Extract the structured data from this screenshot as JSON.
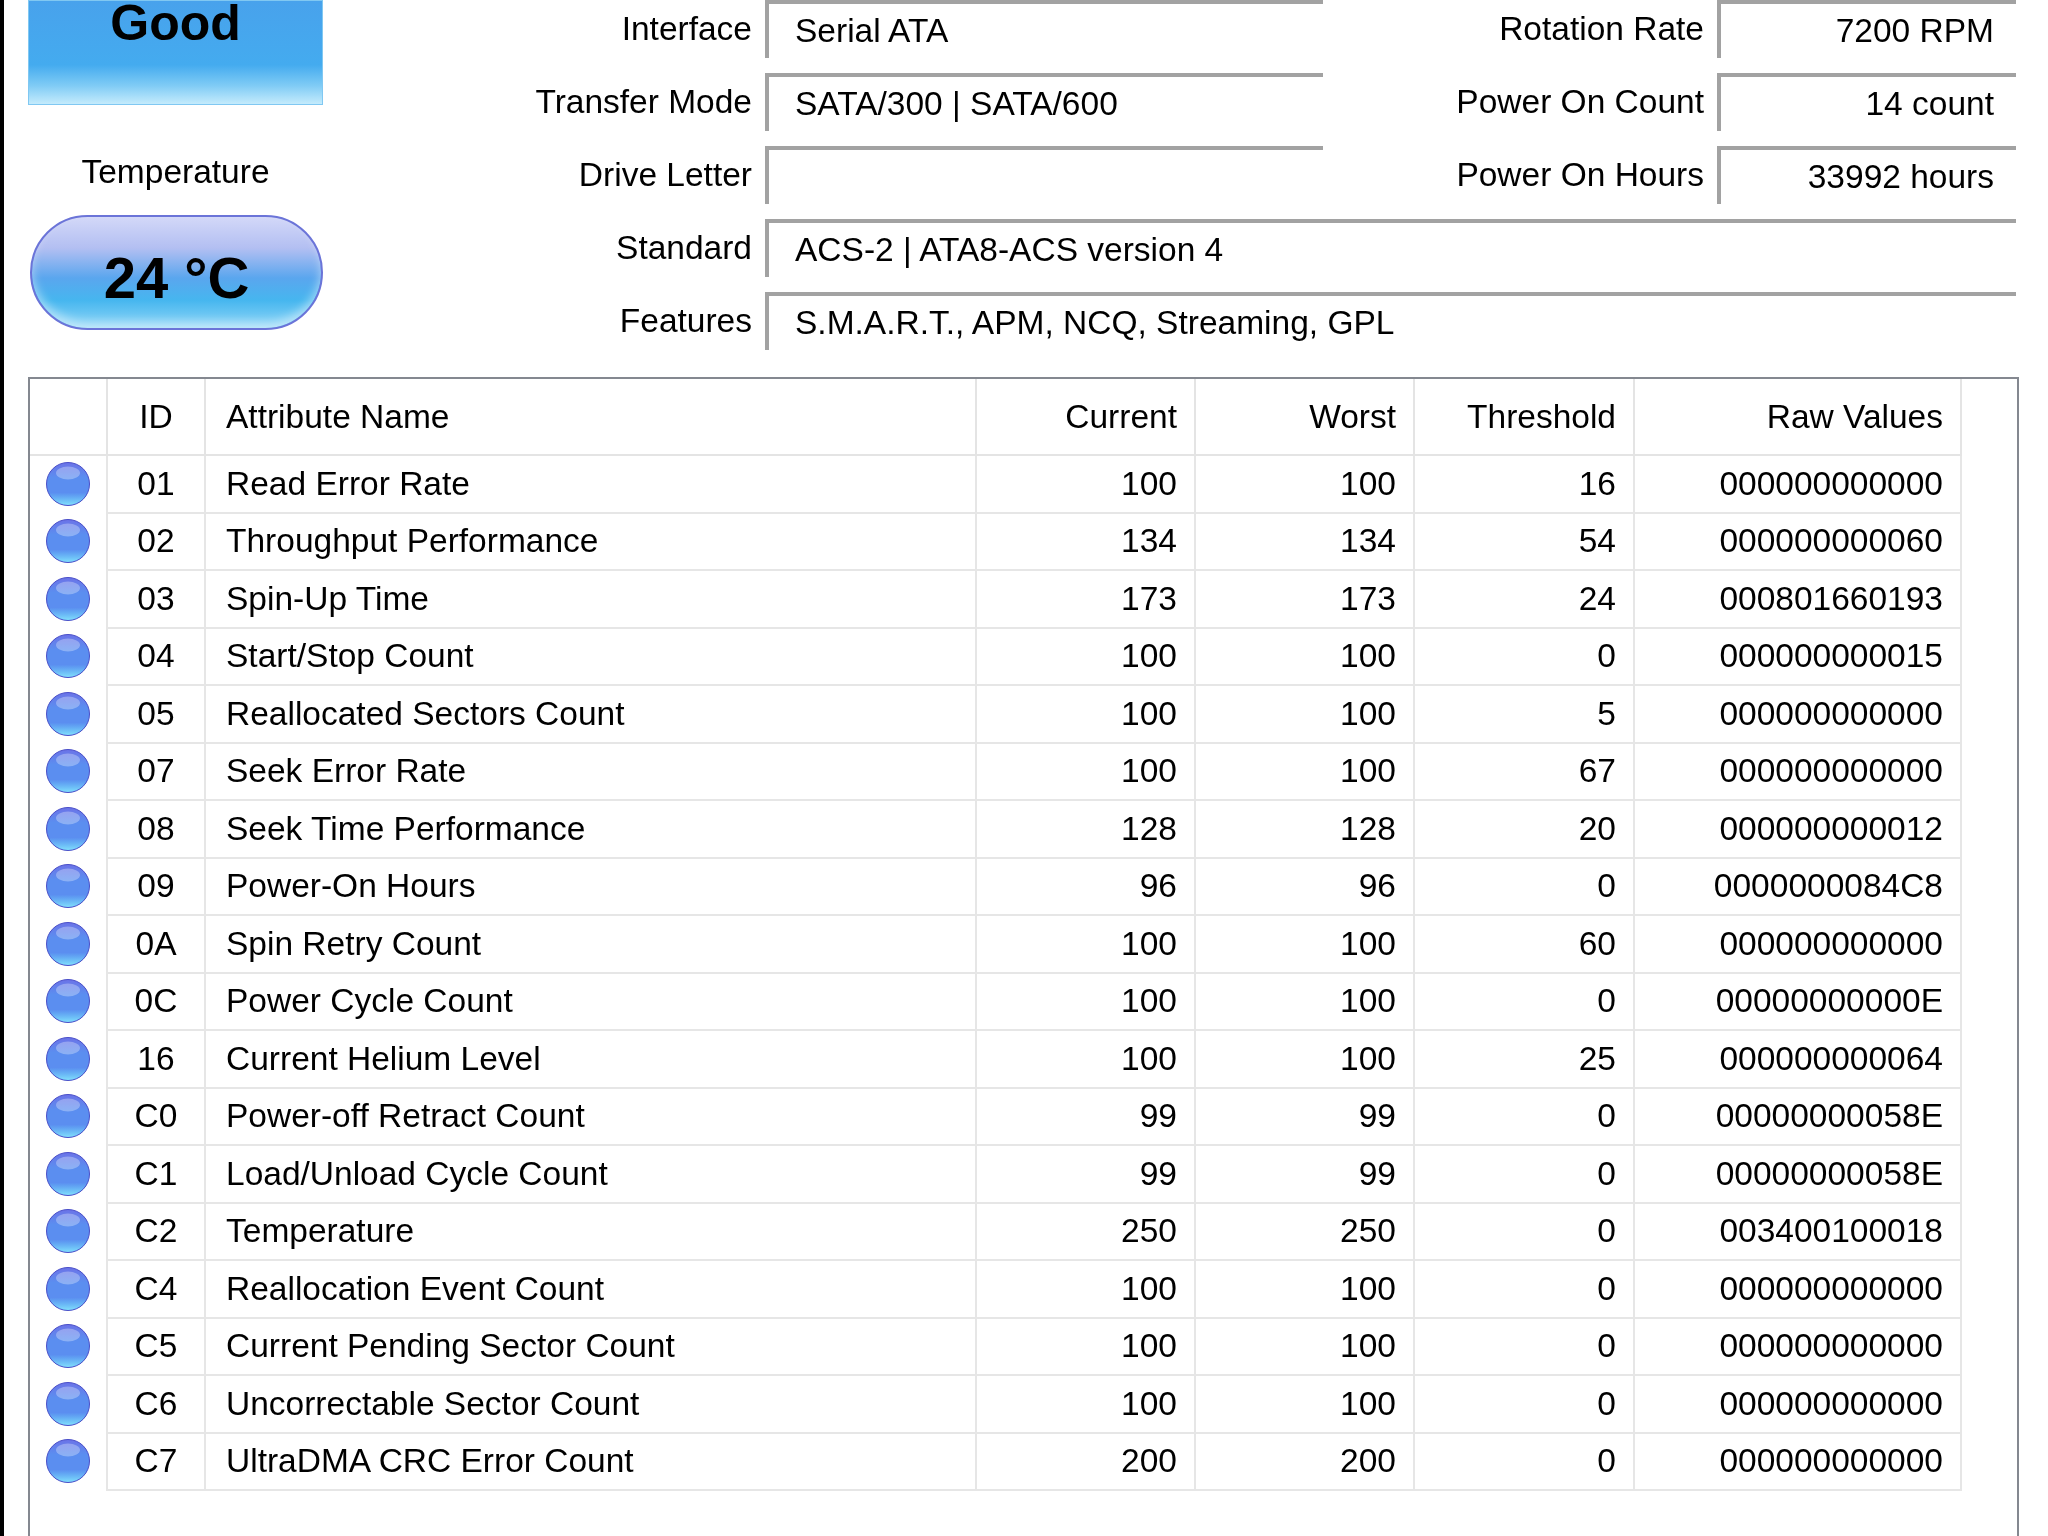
{
  "health": {
    "value": "Good"
  },
  "temperature": {
    "label": "Temperature",
    "value": "24 °C"
  },
  "info_rows": [
    {
      "fields": [
        {
          "label": "Interface",
          "value": "Serial ATA"
        },
        {
          "label": "Rotation Rate",
          "value": "7200 RPM"
        }
      ]
    },
    {
      "fields": [
        {
          "label": "Transfer Mode",
          "value": "SATA/300 | SATA/600"
        },
        {
          "label": "Power On Count",
          "value": "14 count"
        }
      ]
    },
    {
      "fields": [
        {
          "label": "Drive Letter"
        },
        {
          "label": "Power On Hours",
          "value": "33992 hours"
        }
      ]
    },
    {
      "fields": [
        {
          "label": "Standard",
          "value": "ACS-2 | ATA8-ACS version 4"
        }
      ]
    },
    {
      "fields": [
        {
          "label": "Features",
          "value": "S.M.A.R.T., APM, NCQ, Streaming, GPL"
        }
      ]
    }
  ],
  "table": {
    "columns": [
      "ID",
      "Attribute Name",
      "Current",
      "Worst",
      "Threshold",
      "Raw Values"
    ],
    "rows": [
      {
        "color": "#5b8ef0",
        "cells": [
          "01",
          "Read Error Rate",
          "100",
          "100",
          "16",
          "000000000000"
        ]
      },
      {
        "color": "#5b8ef0",
        "cells": [
          "02",
          "Throughput Performance",
          "134",
          "134",
          "54",
          "000000000060"
        ]
      },
      {
        "color": "#5b8ef0",
        "cells": [
          "03",
          "Spin-Up Time",
          "173",
          "173",
          "24",
          "000801660193"
        ]
      },
      {
        "color": "#5b8ef0",
        "cells": [
          "04",
          "Start/Stop Count",
          "100",
          "100",
          "0",
          "000000000015"
        ]
      },
      {
        "color": "#5b8ef0",
        "cells": [
          "05",
          "Reallocated Sectors Count",
          "100",
          "100",
          "5",
          "000000000000"
        ]
      },
      {
        "color": "#5b8ef0",
        "cells": [
          "07",
          "Seek Error Rate",
          "100",
          "100",
          "67",
          "000000000000"
        ]
      },
      {
        "color": "#5b8ef0",
        "cells": [
          "08",
          "Seek Time Performance",
          "128",
          "128",
          "20",
          "000000000012"
        ]
      },
      {
        "color": "#5b8ef0",
        "cells": [
          "09",
          "Power-On Hours",
          "96",
          "96",
          "0",
          "0000000084C8"
        ]
      },
      {
        "color": "#5b8ef0",
        "cells": [
          "0A",
          "Spin Retry Count",
          "100",
          "100",
          "60",
          "000000000000"
        ]
      },
      {
        "color": "#5b8ef0",
        "cells": [
          "0C",
          "Power Cycle Count",
          "100",
          "100",
          "0",
          "00000000000E"
        ]
      },
      {
        "color": "#5b8ef0",
        "cells": [
          "16",
          "Current Helium Level",
          "100",
          "100",
          "25",
          "000000000064"
        ]
      },
      {
        "color": "#5b8ef0",
        "cells": [
          "C0",
          "Power-off Retract Count",
          "99",
          "99",
          "0",
          "00000000058E"
        ]
      },
      {
        "color": "#5b8ef0",
        "cells": [
          "C1",
          "Load/Unload Cycle Count",
          "99",
          "99",
          "0",
          "00000000058E"
        ]
      },
      {
        "color": "#5b8ef0",
        "cells": [
          "C2",
          "Temperature",
          "250",
          "250",
          "0",
          "003400100018"
        ]
      },
      {
        "color": "#5b8ef0",
        "cells": [
          "C4",
          "Reallocation Event Count",
          "100",
          "100",
          "0",
          "000000000000"
        ]
      },
      {
        "color": "#5b8ef0",
        "cells": [
          "C5",
          "Current Pending Sector Count",
          "100",
          "100",
          "0",
          "000000000000"
        ]
      },
      {
        "color": "#5b8ef0",
        "cells": [
          "C6",
          "Uncorrectable Sector Count",
          "100",
          "100",
          "0",
          "000000000000"
        ]
      },
      {
        "color": "#5b8ef0",
        "cells": [
          "C7",
          "UltraDMA CRC Error Count",
          "200",
          "200",
          "0",
          "000000000000"
        ]
      }
    ]
  }
}
